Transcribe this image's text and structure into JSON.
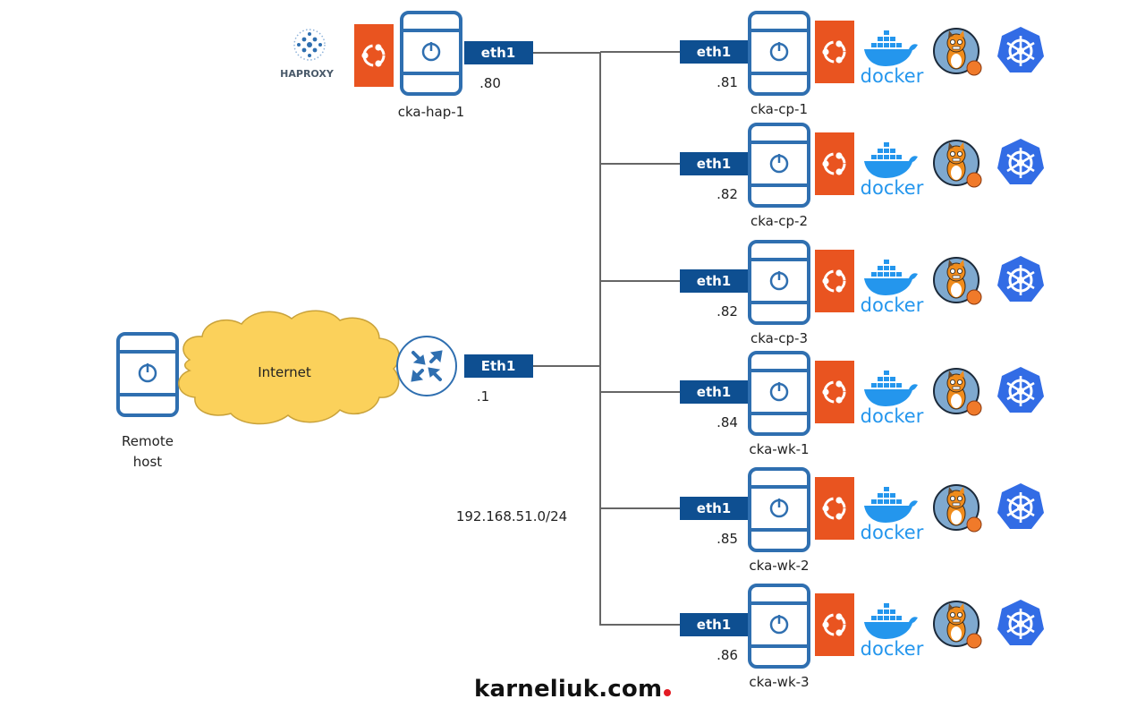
{
  "colors": {
    "server_stroke": "#2f6fb0",
    "badge_fill": "#0e4f91",
    "ubuntu_orange": "#e95420",
    "docker_blue": "#2496ed",
    "k8s_blue": "#326ce5",
    "cloud_fill": "#fbd15b",
    "cloud_stroke": "#c9a23a",
    "bus_line": "#666666",
    "brand_dot": "#e31b23"
  },
  "haproxy_node": {
    "hostname": "cka-hap-1",
    "interface": "eth1",
    "ip_suffix": ".80",
    "logo_text": "HAPROXY",
    "icons": [
      "haproxy-icon",
      "ubuntu-icon"
    ]
  },
  "router": {
    "interface": "Eth1",
    "ip_suffix": ".1",
    "icon": "router-icon"
  },
  "remote_host": {
    "label_line1": "Remote",
    "label_line2": "host"
  },
  "internet": {
    "label": "Internet"
  },
  "network": {
    "subnet": "192.168.51.0/24"
  },
  "nodes": [
    {
      "hostname": "cka-cp-1",
      "interface": "eth1",
      "ip_suffix": ".81",
      "docker_text": "docker"
    },
    {
      "hostname": "cka-cp-2",
      "interface": "eth1",
      "ip_suffix": ".82",
      "docker_text": "docker"
    },
    {
      "hostname": "cka-cp-3",
      "interface": "eth1",
      "ip_suffix": ".82",
      "docker_text": "docker"
    },
    {
      "hostname": "cka-wk-1",
      "interface": "eth1",
      "ip_suffix": ".84",
      "docker_text": "docker"
    },
    {
      "hostname": "cka-wk-2",
      "interface": "eth1",
      "ip_suffix": ".85",
      "docker_text": "docker"
    },
    {
      "hostname": "cka-wk-3",
      "interface": "eth1",
      "ip_suffix": ".86",
      "docker_text": "docker"
    }
  ],
  "node_icons": [
    "ubuntu-icon",
    "docker-icon",
    "containerd-cat-icon",
    "kubernetes-icon"
  ],
  "footer": {
    "brand": "karneliuk.com"
  }
}
